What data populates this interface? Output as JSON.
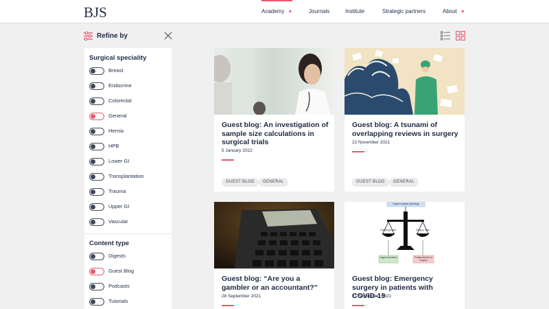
{
  "brand": {
    "logo_text": "BJS",
    "accent": "#e8596b",
    "navy": "#1f2a44"
  },
  "nav": {
    "academy": "Academy",
    "journals": "Journals",
    "institute": "Institute",
    "strategic_partners": "Strategic partners",
    "about": "About",
    "chevron": "⌄"
  },
  "refine": {
    "label": "Refine by",
    "icon": "sliders-icon",
    "close_icon": "close-icon"
  },
  "view_toggle": {
    "list_icon": "list-view-icon",
    "grid_icon": "grid-view-icon",
    "selected": "grid"
  },
  "filters": {
    "surgical_speciality": {
      "title": "Surgical speciality",
      "items": [
        {
          "label": "Breast",
          "on": false
        },
        {
          "label": "Endocrine",
          "on": false
        },
        {
          "label": "Colorectal",
          "on": false
        },
        {
          "label": "General",
          "on": true
        },
        {
          "label": "Hernia",
          "on": false
        },
        {
          "label": "HPB",
          "on": false
        },
        {
          "label": "Lower GI",
          "on": false
        },
        {
          "label": "Transplantation",
          "on": false
        },
        {
          "label": "Trauma",
          "on": false
        },
        {
          "label": "Upper GI",
          "on": false
        },
        {
          "label": "Vascular",
          "on": false
        }
      ]
    },
    "content_type": {
      "title": "Content type",
      "items": [
        {
          "label": "Digests",
          "on": false
        },
        {
          "label": "Guest Blog",
          "on": true
        },
        {
          "label": "Podcasts",
          "on": false
        },
        {
          "label": "Tutorials",
          "on": false
        }
      ]
    }
  },
  "cards": [
    {
      "title": "Guest blog: An investigation of sample size calculations in surgical trials",
      "date": "5 January 2022",
      "tags": [
        "GUEST BLOG",
        "GENERAL"
      ]
    },
    {
      "title": "Guest blog: A tsunami of overlapping reviews in surgery",
      "date": "22 November 2021",
      "tags": [
        "GUEST BLOG",
        "GENERAL"
      ]
    },
    {
      "title": "Guest blog: “Are you a gambler or an accountant?”",
      "date": "28 September 2021",
      "tags": []
    },
    {
      "title": "Guest blog: Emergency surgery in patients with COVID-19",
      "date": "27 September 2021",
      "tags": []
    }
  ],
  "diagram": {
    "top_label": "Urgent surgical pathology",
    "left_pan": "Pathology risks",
    "right_pan": "Surgery risks",
    "left_box": "Urgent operation",
    "right_box": "Postponement of surgery"
  }
}
